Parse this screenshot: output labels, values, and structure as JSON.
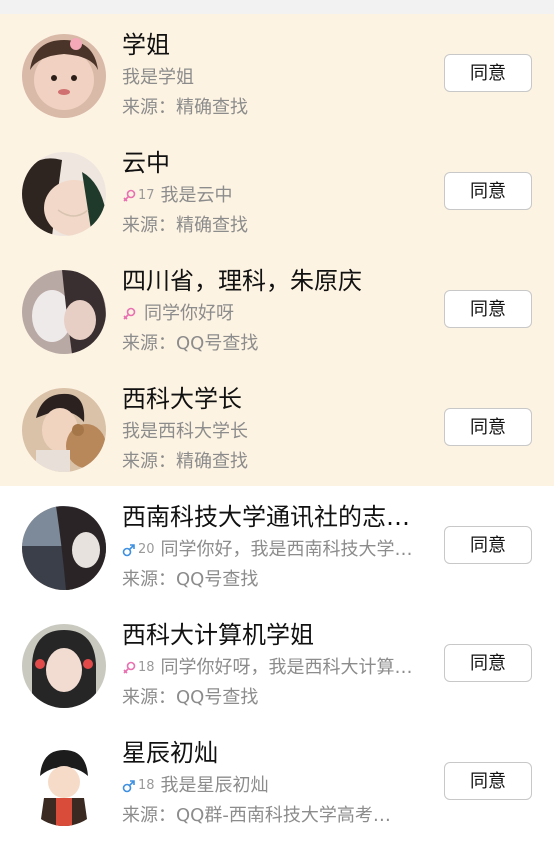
{
  "requests": [
    {
      "name": "学姐",
      "gender": null,
      "age": null,
      "message": "我是学姐",
      "source": "来源：精确查找",
      "button": "同意",
      "highlight": true
    },
    {
      "name": "云中",
      "gender": "female",
      "age": "17",
      "message": "我是云中",
      "source": "来源：精确查找",
      "button": "同意",
      "highlight": true
    },
    {
      "name": "四川省，理科，朱原庆",
      "gender": "female",
      "age": "",
      "message": "同学你好呀",
      "source": "来源：QQ号查找",
      "button": "同意",
      "highlight": true
    },
    {
      "name": "西科大学长",
      "gender": null,
      "age": null,
      "message": "我是西科大学长",
      "source": "来源：精确查找",
      "button": "同意",
      "highlight": true
    },
    {
      "name": "西南科技大学通讯社的志…",
      "gender": "male",
      "age": "20",
      "message": "同学你好，我是西南科技大学…",
      "source": "来源：QQ号查找",
      "button": "同意",
      "highlight": false
    },
    {
      "name": "西科大计算机学姐",
      "gender": "female",
      "age": "18",
      "message": "同学你好呀，我是西科大计算…",
      "source": "来源：QQ号查找",
      "button": "同意",
      "highlight": false
    },
    {
      "name": "星辰初灿",
      "gender": "male",
      "age": "18",
      "message": "我是星辰初灿",
      "source": "来源：QQ群-西南科技大学高考…",
      "button": "同意",
      "highlight": false
    }
  ],
  "colors": {
    "highlight_bg": "#fdf3e3",
    "female": "#e86fb0",
    "male": "#3d8fe0"
  }
}
